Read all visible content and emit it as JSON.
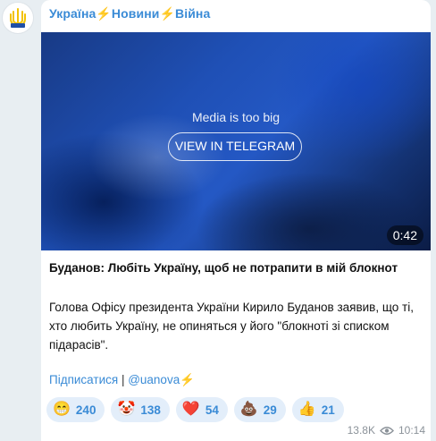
{
  "channel": {
    "title": "Україна⚡Новини⚡Війна",
    "avatar_icon": "trident-emblem-icon"
  },
  "media": {
    "notice": "Media is too big",
    "button_label": "VIEW IN TELEGRAM",
    "duration": "0:42"
  },
  "post": {
    "headline": "Буданов: Любіть Україну, щоб не потрапити в мій блокнот",
    "body": "Голова Офісу президента України Кирило Буданов заявив, що ті, хто любить Україну, не опиняться у його \"блокноті зі списком підарасів\".",
    "subscribe_label": "Підписатися",
    "separator": " | ",
    "channel_link": "@uanova⚡"
  },
  "reactions": [
    {
      "emoji": "😁",
      "count": "240"
    },
    {
      "emoji": "🤡",
      "count": "138"
    },
    {
      "emoji": "❤️",
      "count": "54"
    },
    {
      "emoji": "💩",
      "count": "29"
    },
    {
      "emoji": "👍",
      "count": "21"
    }
  ],
  "meta": {
    "views": "13.8K",
    "views_icon": "eye-icon",
    "time": "10:14"
  },
  "colors": {
    "link": "#3a8bd6",
    "reaction_bg": "#e3eefa",
    "page_bg": "#e8eef2"
  }
}
